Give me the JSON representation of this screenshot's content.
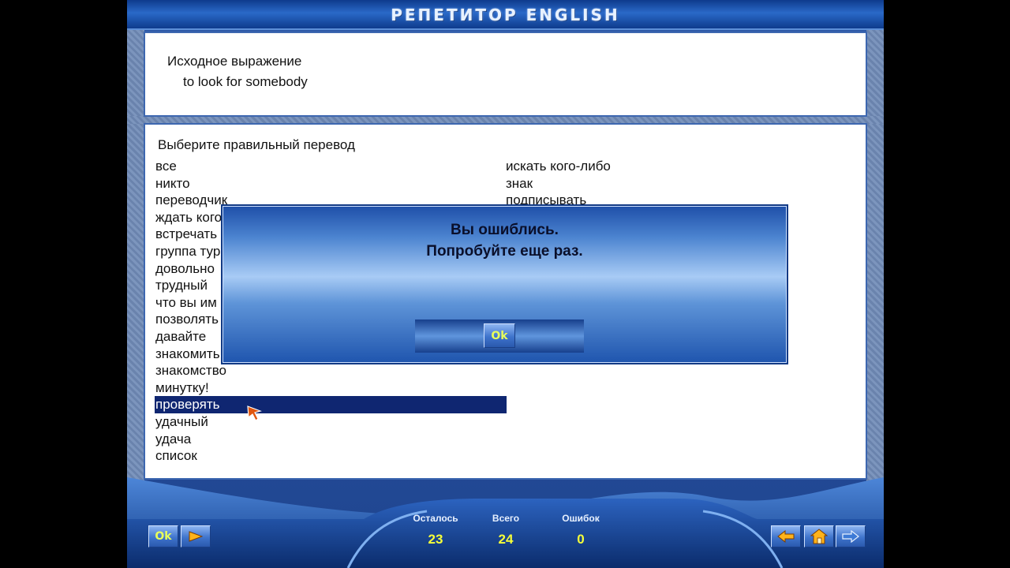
{
  "app": {
    "title": "РЕПЕТИТОР ENGLISH"
  },
  "source": {
    "label": "Исходное выражение",
    "phrase": "to look for somebody"
  },
  "choices": {
    "instruction": "Выберите правильный перевод",
    "left": [
      "все",
      "никто",
      "переводчик",
      "ждать кого",
      "встречать",
      "группа тур",
      "довольно",
      "трудный",
      "что вы им",
      "позволять",
      "давайте",
      "знакомить",
      "знакомство",
      "минутку!",
      "проверять",
      "удачный",
      "удача",
      "список"
    ],
    "right": [
      "искать кого-либо",
      "знак",
      "подписывать"
    ],
    "selected_left_index": 14
  },
  "dialog": {
    "line1": "Вы ошиблись.",
    "line2": "Попробуйте еще раз.",
    "ok_label": "Ok"
  },
  "footer": {
    "ok_label": "Ok",
    "stats": {
      "remaining_label": "Осталось",
      "remaining_value": "23",
      "total_label": "Всего",
      "total_value": "24",
      "errors_label": "Ошибок",
      "errors_value": "0"
    }
  },
  "colors": {
    "selection": "#0f2671",
    "accent_yellow": "#f6ff39",
    "frame_blue": "#1f4590"
  },
  "icons": {
    "next": "play-triangle-icon",
    "back": "arrow-left-icon",
    "home": "home-icon",
    "forward": "arrow-right-icon",
    "cursor": "mouse-pointer-icon"
  }
}
